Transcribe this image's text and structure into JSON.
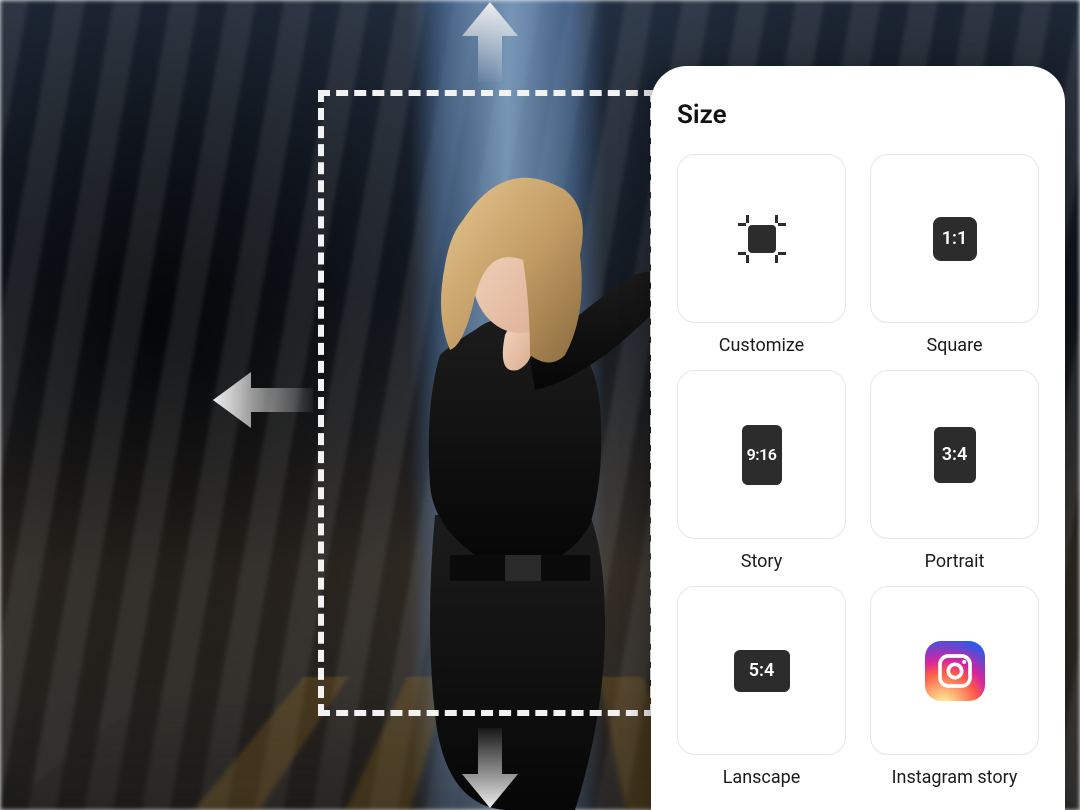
{
  "panel": {
    "title": "Size",
    "options": [
      {
        "label": "Customize",
        "icon": "crop"
      },
      {
        "label": "Square",
        "ratio": "1:1",
        "shape": "square"
      },
      {
        "label": "Story",
        "ratio": "9:16",
        "shape": "story"
      },
      {
        "label": "Portrait",
        "ratio": "3:4",
        "shape": "portrait"
      },
      {
        "label": "Lanscape",
        "ratio": "5:4",
        "shape": "landscape"
      },
      {
        "label": "Instagram story",
        "icon": "instagram"
      }
    ]
  },
  "canvas": {
    "crop_marquee": true,
    "expand_arrows": [
      "up",
      "down",
      "left",
      "right"
    ]
  }
}
